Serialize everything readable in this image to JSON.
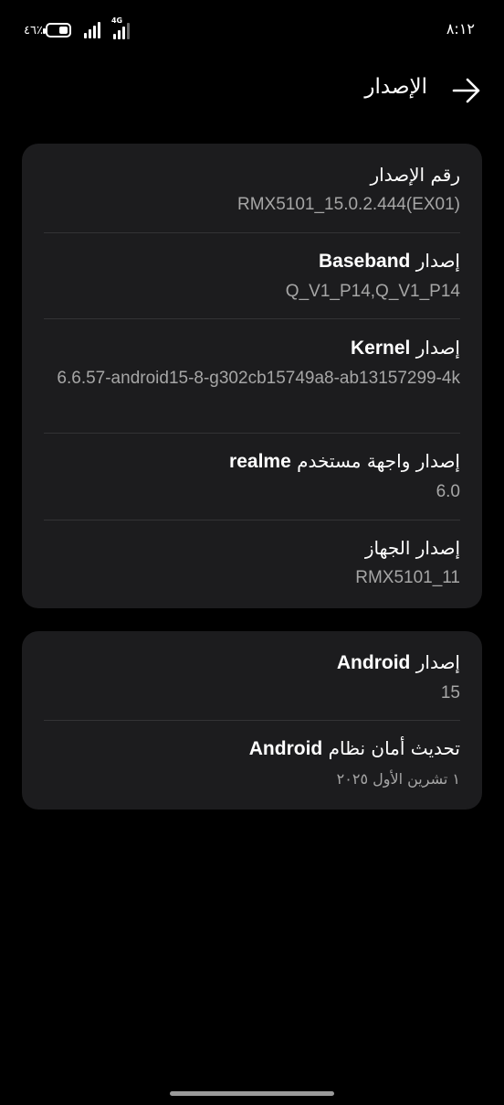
{
  "status_bar": {
    "time": "٨:١٢",
    "battery_percent": "٤٦٪",
    "battery_level": 0.46,
    "network_label": "4G"
  },
  "header": {
    "title": "الإصدار",
    "back_icon": "arrow-right-icon"
  },
  "card_build": {
    "rows": [
      {
        "title_ar": "رقم الإصدار",
        "title_en": "",
        "value": "RMX5101_15.0.2.444(EX01)"
      },
      {
        "title_ar": "إصدار",
        "title_en": "Baseband",
        "value": "Q_V1_P14,Q_V1_P14"
      },
      {
        "title_ar": "إصدار",
        "title_en": "Kernel",
        "value": "6.6.57-android15-8-g302cb15749a8-ab13157299-4k"
      },
      {
        "title_ar": "إصدار واجهة مستخدم",
        "title_en": "realme",
        "value": "6.0"
      },
      {
        "title_ar": "إصدار الجهاز",
        "title_en": "",
        "value": "RMX5101_11"
      }
    ]
  },
  "card_android": {
    "rows": [
      {
        "title_ar": "إصدار",
        "title_en": "Android",
        "value": "15"
      },
      {
        "title_ar": "تحديث أمان نظام",
        "title_en": "Android",
        "value": "١ تشرين الأول ٢٠٢٥"
      }
    ]
  },
  "colors": {
    "background": "#000000",
    "card": "#1c1c1e",
    "primary_text": "#ffffff",
    "secondary_text": "#a6a6a6"
  }
}
